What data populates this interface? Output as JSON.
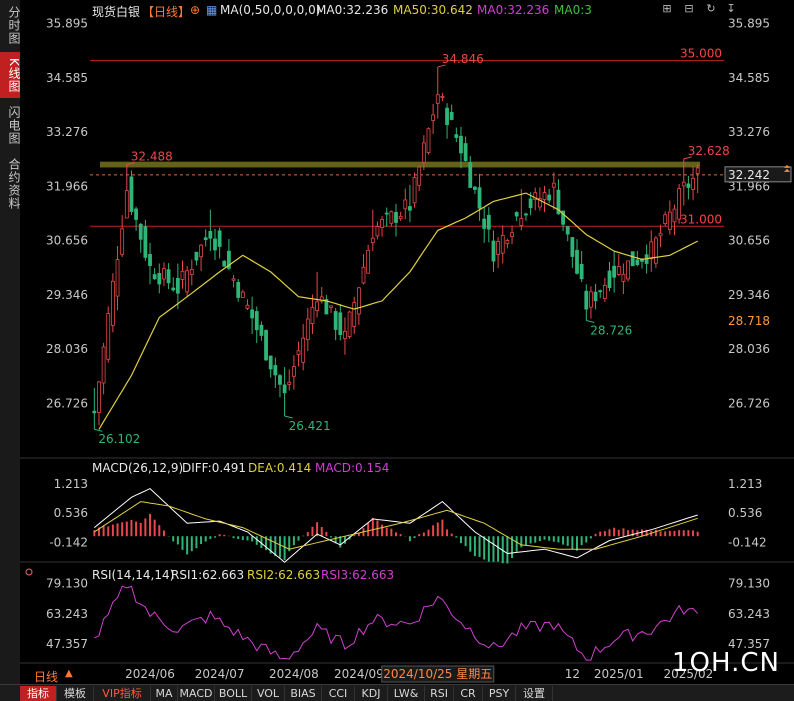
{
  "sidebar": {
    "tabs": [
      {
        "label": "分时图",
        "active": false
      },
      {
        "label": "K线图",
        "active": true
      },
      {
        "label": "闪电图",
        "active": false
      },
      {
        "label": "合约资料",
        "active": false
      }
    ]
  },
  "header": {
    "title": "现货白银",
    "period": "【日线】",
    "ma_params": "MA(0,50,0,0,0,0)",
    "ma0_a": "MA0:32.236",
    "ma50": "MA50:30.642",
    "ma0_b": "MA0:32.236",
    "ma0_c": "MA0:3"
  },
  "colors": {
    "up": "#e8474b",
    "down": "#2fb577",
    "ma50": "#e0d040",
    "diff": "#ffffff",
    "dea": "#e0d040",
    "rsi": "#d040d0",
    "hline": "#c42020",
    "band": "#6f6d1a",
    "axis_text": "#c8c8c8"
  },
  "price_panel": {
    "yticks": [
      "35.895",
      "34.585",
      "33.276",
      "31.966",
      "30.656",
      "29.346",
      "28.036",
      "26.726"
    ],
    "ytick_values": [
      35.895,
      34.585,
      33.276,
      31.966,
      30.656,
      29.346,
      28.036,
      26.726
    ],
    "current_price_label": "32.242",
    "current_price": 32.242,
    "cursor_price_label": "28.718",
    "cursor_price": 28.718,
    "lines": [
      {
        "label": "35.000",
        "value": 35.0
      },
      {
        "label": "31.000",
        "value": 31.0
      }
    ],
    "band": {
      "low": 32.42,
      "high": 32.56
    },
    "annotations": [
      {
        "label": "34.846",
        "value": 34.846,
        "index": 74,
        "color": "#e8474b"
      },
      {
        "label": "32.488",
        "value": 32.488,
        "index": 7,
        "color": "#e8474b"
      },
      {
        "label": "32.628",
        "value": 32.628,
        "index": 127,
        "color": "#e8474b"
      },
      {
        "label": "26.102",
        "value": 26.102,
        "index": 0,
        "color": "#2fb577"
      },
      {
        "label": "26.421",
        "value": 26.421,
        "index": 41,
        "color": "#2fb577"
      },
      {
        "label": "28.726",
        "value": 28.726,
        "index": 106,
        "color": "#2fb577"
      }
    ]
  },
  "macd_panel": {
    "title": "MACD(26,12,9)",
    "diff_label": "DIFF:0.491",
    "dea_label": "DEA:0.414",
    "macd_label": "MACD:0.154",
    "yticks": [
      "1.213",
      "0.536",
      "-0.142"
    ],
    "ytick_values": [
      1.213,
      0.536,
      -0.142
    ]
  },
  "rsi_panel": {
    "title": "RSI(14,14,14)",
    "rsi1_label": "RSI1:62.663",
    "rsi2_label": "RSI2:62.663",
    "rsi3_label": "RSI3:62.663",
    "yticks": [
      "79.130",
      "63.243",
      "47.357"
    ],
    "ytick_values": [
      79.13,
      63.243,
      47.357
    ]
  },
  "xaxis": {
    "labels": [
      {
        "text": "2024/06",
        "index": 12
      },
      {
        "text": "2024/07",
        "index": 27
      },
      {
        "text": "2024/08",
        "index": 43
      },
      {
        "text": "2024/09",
        "index": 57
      },
      {
        "text": "2024/10",
        "index": 71
      },
      {
        "text": "12",
        "index": 103
      },
      {
        "text": "2025/01",
        "index": 113
      },
      {
        "text": "2025/02",
        "index": 128
      }
    ],
    "cursor_date": "2024/10/25 星期五"
  },
  "period_selector": "日线",
  "watermark": "1OH.CN",
  "bottom_tabs": [
    "指标",
    "模板",
    "VIP指标",
    "MA",
    "MACD",
    "BOLL",
    "VOL",
    "BIAS",
    "CCI",
    "KDJ",
    "LW&",
    "RSI",
    "CR",
    "PSY",
    "设置"
  ],
  "chart_data": {
    "type": "candlestick",
    "title": "现货白银",
    "ylim": [
      25.6,
      36.1
    ],
    "anchors": [
      {
        "index": 0,
        "close": 26.5,
        "high": 27.1,
        "low": 26.102
      },
      {
        "index": 7,
        "close": 31.9,
        "high": 32.488,
        "low": 31.2
      },
      {
        "index": 12,
        "close": 30.0,
        "high": 30.6,
        "low": 29.6
      },
      {
        "index": 18,
        "close": 29.5,
        "high": 30.1,
        "low": 29.0
      },
      {
        "index": 25,
        "close": 30.9,
        "high": 31.4,
        "low": 30.4
      },
      {
        "index": 34,
        "close": 28.8,
        "high": 29.3,
        "low": 28.4
      },
      {
        "index": 41,
        "close": 26.9,
        "high": 27.6,
        "low": 26.421
      },
      {
        "index": 48,
        "close": 29.4,
        "high": 29.9,
        "low": 28.8
      },
      {
        "index": 54,
        "close": 28.3,
        "high": 28.8,
        "low": 27.9
      },
      {
        "index": 60,
        "close": 30.9,
        "high": 31.4,
        "low": 30.4
      },
      {
        "index": 68,
        "close": 31.5,
        "high": 32.0,
        "low": 31.1
      },
      {
        "index": 74,
        "close": 34.2,
        "high": 34.846,
        "low": 33.6
      },
      {
        "index": 79,
        "close": 32.9,
        "high": 33.4,
        "low": 32.4
      },
      {
        "index": 86,
        "close": 30.4,
        "high": 30.9,
        "low": 29.9
      },
      {
        "index": 92,
        "close": 31.4,
        "high": 31.9,
        "low": 30.9
      },
      {
        "index": 99,
        "close": 31.9,
        "high": 32.3,
        "low": 31.4
      },
      {
        "index": 106,
        "close": 29.1,
        "high": 29.6,
        "low": 28.726
      },
      {
        "index": 112,
        "close": 29.9,
        "high": 30.4,
        "low": 29.4
      },
      {
        "index": 120,
        "close": 30.4,
        "high": 30.9,
        "low": 29.9
      },
      {
        "index": 127,
        "close": 31.9,
        "high": 32.628,
        "low": 31.5
      },
      {
        "index": 130,
        "close": 32.24,
        "high": 32.5,
        "low": 31.8
      }
    ],
    "ma50_anchors": [
      {
        "index": 1,
        "value": 26.1
      },
      {
        "index": 8,
        "value": 27.4
      },
      {
        "index": 14,
        "value": 28.8
      },
      {
        "index": 20,
        "value": 29.3
      },
      {
        "index": 27,
        "value": 29.9
      },
      {
        "index": 32,
        "value": 30.3
      },
      {
        "index": 38,
        "value": 29.9
      },
      {
        "index": 44,
        "value": 29.3
      },
      {
        "index": 50,
        "value": 29.2
      },
      {
        "index": 56,
        "value": 29.0
      },
      {
        "index": 62,
        "value": 29.2
      },
      {
        "index": 68,
        "value": 29.9
      },
      {
        "index": 74,
        "value": 30.9
      },
      {
        "index": 80,
        "value": 31.2
      },
      {
        "index": 86,
        "value": 31.6
      },
      {
        "index": 93,
        "value": 31.8
      },
      {
        "index": 100,
        "value": 31.4
      },
      {
        "index": 106,
        "value": 30.8
      },
      {
        "index": 112,
        "value": 30.4
      },
      {
        "index": 118,
        "value": 30.2
      },
      {
        "index": 124,
        "value": 30.3
      },
      {
        "index": 130,
        "value": 30.642
      }
    ],
    "macd_diff_anchors": [
      {
        "index": 0,
        "value": 0.2
      },
      {
        "index": 8,
        "value": 0.9
      },
      {
        "index": 12,
        "value": 1.1
      },
      {
        "index": 20,
        "value": 0.3
      },
      {
        "index": 27,
        "value": 0.35
      },
      {
        "index": 33,
        "value": 0.1
      },
      {
        "index": 41,
        "value": -0.6
      },
      {
        "index": 48,
        "value": 0.05
      },
      {
        "index": 53,
        "value": -0.2
      },
      {
        "index": 60,
        "value": 0.4
      },
      {
        "index": 68,
        "value": 0.3
      },
      {
        "index": 75,
        "value": 0.8
      },
      {
        "index": 82,
        "value": 0.1
      },
      {
        "index": 89,
        "value": -0.4
      },
      {
        "index": 97,
        "value": -0.3
      },
      {
        "index": 104,
        "value": -0.5
      },
      {
        "index": 111,
        "value": -0.1
      },
      {
        "index": 120,
        "value": 0.15
      },
      {
        "index": 130,
        "value": 0.491
      }
    ],
    "macd_dea_anchors": [
      {
        "index": 0,
        "value": 0.1
      },
      {
        "index": 10,
        "value": 0.8
      },
      {
        "index": 16,
        "value": 0.7
      },
      {
        "index": 24,
        "value": 0.4
      },
      {
        "index": 32,
        "value": 0.2
      },
      {
        "index": 42,
        "value": -0.3
      },
      {
        "index": 50,
        "value": -0.1
      },
      {
        "index": 58,
        "value": 0.1
      },
      {
        "index": 66,
        "value": 0.3
      },
      {
        "index": 76,
        "value": 0.6
      },
      {
        "index": 84,
        "value": 0.3
      },
      {
        "index": 92,
        "value": -0.2
      },
      {
        "index": 100,
        "value": -0.3
      },
      {
        "index": 108,
        "value": -0.3
      },
      {
        "index": 118,
        "value": 0.0
      },
      {
        "index": 130,
        "value": 0.414
      }
    ],
    "rsi_anchors": [
      {
        "index": 0,
        "value": 49
      },
      {
        "index": 7,
        "value": 79
      },
      {
        "index": 12,
        "value": 63
      },
      {
        "index": 18,
        "value": 55
      },
      {
        "index": 25,
        "value": 62
      },
      {
        "index": 34,
        "value": 48
      },
      {
        "index": 41,
        "value": 39
      },
      {
        "index": 48,
        "value": 55
      },
      {
        "index": 54,
        "value": 47
      },
      {
        "index": 60,
        "value": 60
      },
      {
        "index": 68,
        "value": 58
      },
      {
        "index": 74,
        "value": 72
      },
      {
        "index": 80,
        "value": 57
      },
      {
        "index": 86,
        "value": 45
      },
      {
        "index": 92,
        "value": 55
      },
      {
        "index": 99,
        "value": 58
      },
      {
        "index": 106,
        "value": 40
      },
      {
        "index": 112,
        "value": 50
      },
      {
        "index": 120,
        "value": 55
      },
      {
        "index": 127,
        "value": 66
      },
      {
        "index": 130,
        "value": 62.663
      }
    ],
    "count": 131
  }
}
